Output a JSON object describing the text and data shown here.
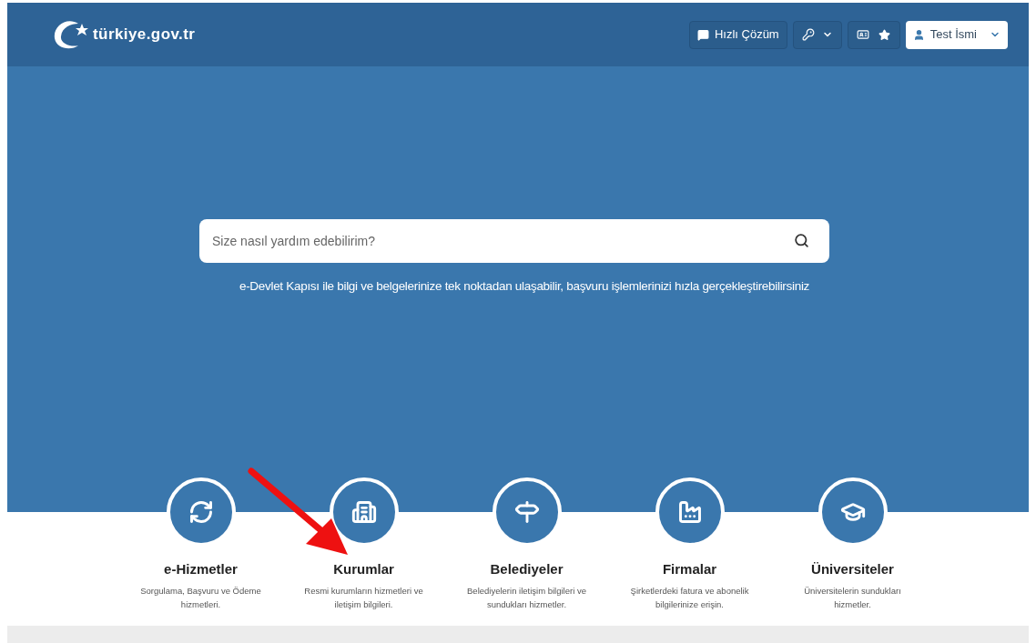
{
  "header": {
    "logo_text": "türkiye.gov.tr",
    "quick_solution": "Hızlı Çözüm",
    "user": "Test İsmi"
  },
  "search": {
    "placeholder": "Size nasıl yardım edebilirim?"
  },
  "tagline": "e-Devlet Kapısı ile bilgi ve belgelerinize tek noktadan ulaşabilir, başvuru işlemlerinizi hızla gerçekleştirebilirsiniz",
  "categories": [
    {
      "title": "e-Hizmetler",
      "description": "Sorgulama, Başvuru ve Ödeme hizmetleri."
    },
    {
      "title": "Kurumlar",
      "description": "Resmi kurumların hizmetleri ve iletişim bilgileri."
    },
    {
      "title": "Belediyeler",
      "description": "Belediyelerin iletişim bilgileri ve sundukları hizmetler."
    },
    {
      "title": "Firmalar",
      "description": "Şirketlerdeki fatura ve abonelik bilgilerinize erişin."
    },
    {
      "title": "Üniversiteler",
      "description": "Üniversitelerin sundukları hizmetler."
    }
  ]
}
